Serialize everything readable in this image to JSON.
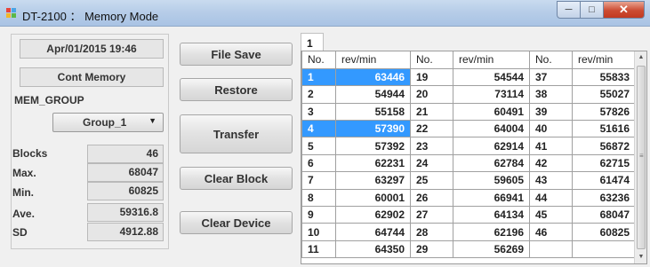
{
  "window": {
    "title": "DT-2100 ： Memory Mode"
  },
  "panel": {
    "datetime": "Apr/01/2015 19:46",
    "memory_mode": "Cont Memory",
    "group_label": "MEM_GROUP",
    "group_selected": "Group_1",
    "stats": [
      {
        "label": "Blocks",
        "value": "46"
      },
      {
        "label": "Max.",
        "value": "68047"
      },
      {
        "label": "Min.",
        "value": "60825"
      },
      {
        "label": "Ave.",
        "value": "59316.8"
      },
      {
        "label": "SD",
        "value": "4912.88"
      }
    ]
  },
  "buttons": {
    "file_save": "File Save",
    "restore": "Restore",
    "transfer": "Transfer",
    "clear_block": "Clear Block",
    "clear_device": "Clear Device"
  },
  "tab": {
    "label": "1"
  },
  "table": {
    "headers": [
      "No.",
      "rev/min",
      "No.",
      "rev/min",
      "No.",
      "rev/min"
    ],
    "selected_rows": [
      0,
      3
    ],
    "rows": [
      [
        "1",
        "63446",
        "19",
        "54544",
        "37",
        "55833"
      ],
      [
        "2",
        "54944",
        "20",
        "73114",
        "38",
        "55027"
      ],
      [
        "3",
        "55158",
        "21",
        "60491",
        "39",
        "57826"
      ],
      [
        "4",
        "57390",
        "22",
        "64004",
        "40",
        "51616"
      ],
      [
        "5",
        "57392",
        "23",
        "62914",
        "41",
        "56872"
      ],
      [
        "6",
        "62231",
        "24",
        "62784",
        "42",
        "62715"
      ],
      [
        "7",
        "63297",
        "25",
        "59605",
        "43",
        "61474"
      ],
      [
        "8",
        "60001",
        "26",
        "66941",
        "44",
        "63236"
      ],
      [
        "9",
        "62902",
        "27",
        "64134",
        "45",
        "68047"
      ],
      [
        "10",
        "64744",
        "28",
        "62196",
        "46",
        "60825"
      ],
      [
        "11",
        "64350",
        "29",
        "56269",
        "",
        ""
      ]
    ]
  },
  "icons": {
    "app": "app-icon",
    "minimize": "minimize-icon",
    "maximize": "maximize-icon",
    "close": "close-icon",
    "dropdown": "chevron-down-icon"
  },
  "colors": {
    "selection": "#3399ff",
    "close_button": "#c94631"
  }
}
